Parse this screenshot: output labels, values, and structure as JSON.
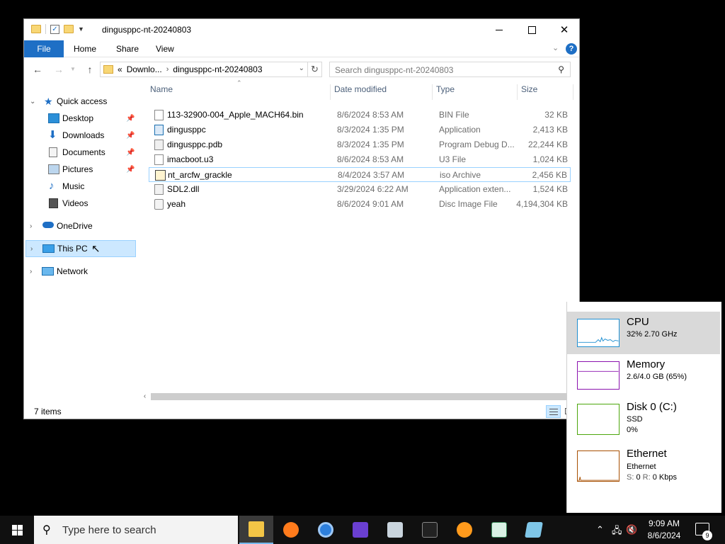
{
  "window": {
    "title": "dingusppc-nt-20240803",
    "minimize_label": "Minimize",
    "maximize_label": "Maximize",
    "close_label": "Close"
  },
  "ribbon": {
    "tabs": [
      "File",
      "Home",
      "Share",
      "View"
    ],
    "help": "?"
  },
  "navigation": {
    "address_segments": [
      "«",
      "Downlo...",
      "dingusppc-nt-20240803"
    ],
    "search_placeholder": "Search dingusppc-nt-20240803"
  },
  "nav_pane": {
    "quick_access": "Quick access",
    "items": [
      "Desktop",
      "Downloads",
      "Documents",
      "Pictures",
      "Music",
      "Videos"
    ],
    "onedrive": "OneDrive",
    "this_pc": "This PC",
    "network": "Network"
  },
  "columns": {
    "name": "Name",
    "date": "Date modified",
    "type": "Type",
    "size": "Size"
  },
  "files": [
    {
      "name": "113-32900-004_Apple_MACH64.bin",
      "date": "8/6/2024 8:53 AM",
      "type": "BIN File",
      "size": "32 KB"
    },
    {
      "name": "dingusppc",
      "date": "8/3/2024 1:35 PM",
      "type": "Application",
      "size": "2,413 KB"
    },
    {
      "name": "dingusppc.pdb",
      "date": "8/3/2024 1:35 PM",
      "type": "Program Debug D...",
      "size": "22,244 KB"
    },
    {
      "name": "imacboot.u3",
      "date": "8/6/2024 8:53 AM",
      "type": "U3 File",
      "size": "1,024 KB"
    },
    {
      "name": "nt_arcfw_grackle",
      "date": "8/4/2024 3:57 AM",
      "type": "iso Archive",
      "size": "2,456 KB"
    },
    {
      "name": "SDL2.dll",
      "date": "3/29/2024 6:22 AM",
      "type": "Application exten...",
      "size": "1,524 KB"
    },
    {
      "name": "yeah",
      "date": "8/6/2024 9:01 AM",
      "type": "Disc Image File",
      "size": "4,194,304 KB"
    }
  ],
  "status": {
    "count": "7 items"
  },
  "performance": {
    "cpu": {
      "title": "CPU",
      "sub": "32% 2.70 GHz",
      "color": "#1f8fd1"
    },
    "memory": {
      "title": "Memory",
      "sub": "2.6/4.0 GB (65%)",
      "color": "#8b12ae"
    },
    "disk": {
      "title": "Disk 0 (C:)",
      "sub1": "SSD",
      "sub2": "0%",
      "color": "#4da60c"
    },
    "ethernet": {
      "title": "Ethernet",
      "sub1": "Ethernet",
      "sub_s": "S:",
      "sub_s_val": "0",
      "sub_r": "R:",
      "sub_r_val": "0 Kbps",
      "color": "#a74f01"
    }
  },
  "taskbar": {
    "search_placeholder": "Type here to search",
    "clock_time": "9:09 AM",
    "clock_date": "8/6/2024",
    "notifications": "9"
  }
}
